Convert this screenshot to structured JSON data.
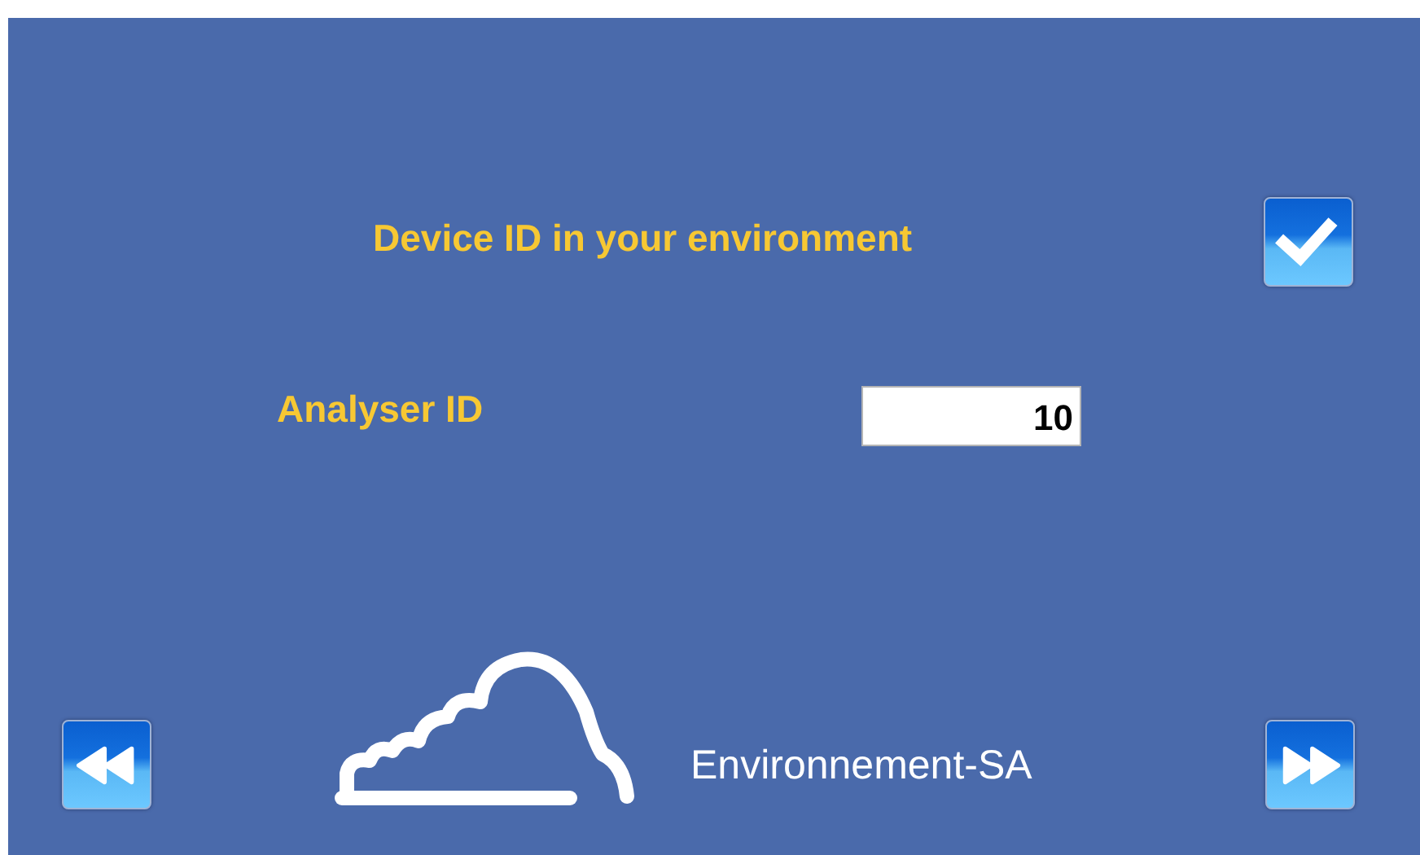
{
  "title": "Device ID in your environment",
  "field": {
    "label": "Analyser ID",
    "value": "10"
  },
  "brand": "Environnement-SA",
  "buttons": [
    {
      "kind": "confirm"
    },
    {
      "kind": "back"
    },
    {
      "kind": "forward"
    }
  ]
}
